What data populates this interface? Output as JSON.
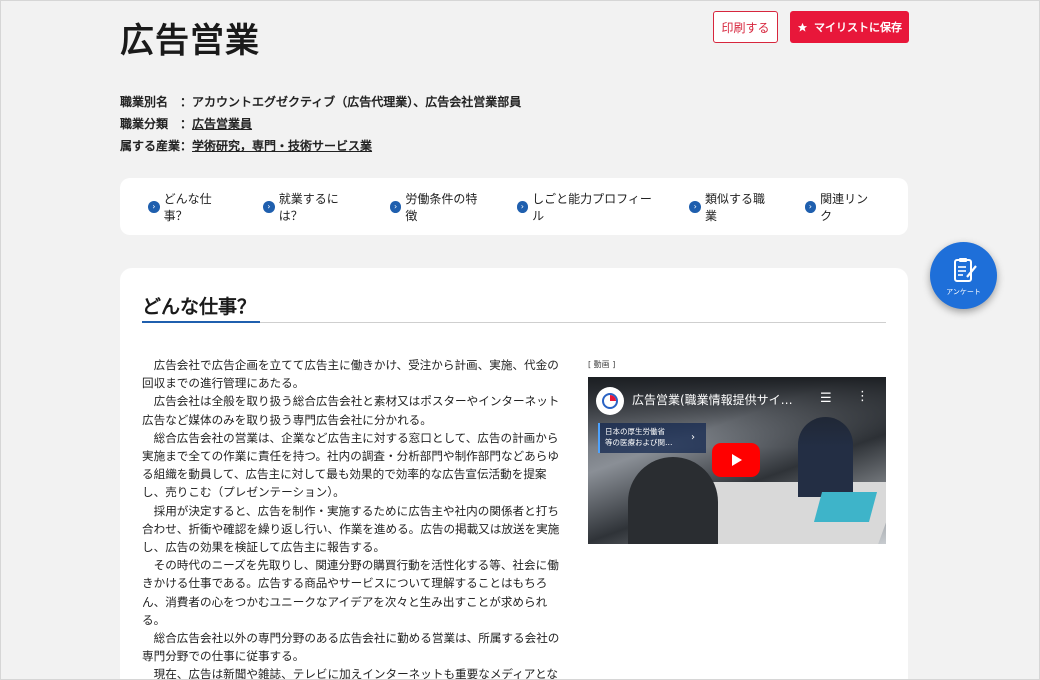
{
  "job": {
    "title": "広告営業",
    "print_label": "印刷する",
    "save_label": "マイリストに保存"
  },
  "meta": {
    "alias_key": "職業別名",
    "alias_value": "：アカウントエグゼクティブ（広告代理業）、広告会社営業部員",
    "category_key": "職業分類",
    "category_sep": "：",
    "category_value": "広告営業員",
    "industry_key": "属する産業",
    "industry_sep": "：",
    "industry_value": "学術研究，専門・技術サービス業"
  },
  "nav": [
    {
      "label": "どんな仕事？"
    },
    {
      "label": "就業するには？"
    },
    {
      "label": "労働条件の特徴"
    },
    {
      "label": "しごと能力プロフィール"
    },
    {
      "label": "類似する職業"
    },
    {
      "label": "関連リンク"
    }
  ],
  "survey": {
    "label": "アンケート"
  },
  "section": {
    "title": "どんな仕事？",
    "paragraphs": [
      "広告会社で広告企画を立てて広告主に働きかけ、受注から計画、実施、代金の回収までの進行管理にあたる。",
      "広告会社は全般を取り扱う総合広告会社と素材又はポスターやインターネット広告など媒体のみを取り扱う専門広告会社に分かれる。",
      "総合広告会社の営業は、企業など広告主に対する窓口として、広告の計画から実施まで全ての作業に責任を持つ。社内の調査・分析部門や制作部門などあらゆる組織を動員して、広告主に対して最も効果的で効率的な広告宣伝活動を提案し、売りこむ（プレゼンテーション）。",
      "採用が決定すると、広告を制作・実施するために広告主や社内の関係者と打ち合わせ、折衝や確認を繰り返し行い、作業を進める。広告の掲載又は放送を実施し、広告の効果を検証して広告主に報告する。",
      "その時代のニーズを先取りし、関連分野の購買行動を活性化する等、社会に働きかける仕事である。広告する商品やサービスについて理解することはもちろん、消費者の心をつかむユニークなアイデアを次々と生み出すことが求められる。",
      "総合広告会社以外の専門分野のある広告会社に勤める営業は、所属する会社の専門分野での仕事に従事する。",
      "現在、広告は新聞や雑誌、テレビに加えインターネットも重要なメディアとなっている。"
    ]
  },
  "video": {
    "label": "[ 動画 ]",
    "title": "広告営業(職業情報提供サイ…",
    "caption_line1": "日本の厚生労働省",
    "caption_line2": "等の医療および関…",
    "icons": [
      "list-icon",
      "more-icon",
      "play-icon"
    ]
  },
  "colors": {
    "accent_red": "#e8173a",
    "nav_blue": "#1f5fae",
    "survey_blue": "#1e6fd9"
  }
}
